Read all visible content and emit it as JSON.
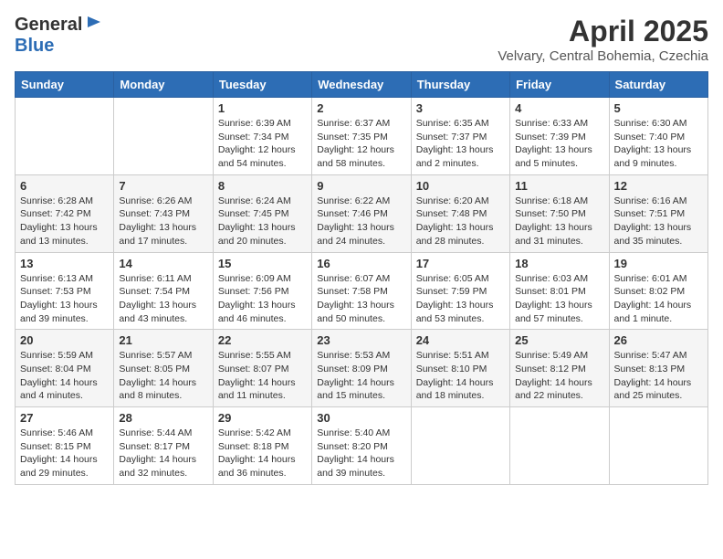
{
  "header": {
    "logo": {
      "general": "General",
      "blue": "Blue"
    },
    "title": "April 2025",
    "location": "Velvary, Central Bohemia, Czechia"
  },
  "weekdays": [
    "Sunday",
    "Monday",
    "Tuesday",
    "Wednesday",
    "Thursday",
    "Friday",
    "Saturday"
  ],
  "weeks": [
    [
      {
        "day": "",
        "sunrise": "",
        "sunset": "",
        "daylight": ""
      },
      {
        "day": "",
        "sunrise": "",
        "sunset": "",
        "daylight": ""
      },
      {
        "day": "1",
        "sunrise": "Sunrise: 6:39 AM",
        "sunset": "Sunset: 7:34 PM",
        "daylight": "Daylight: 12 hours and 54 minutes."
      },
      {
        "day": "2",
        "sunrise": "Sunrise: 6:37 AM",
        "sunset": "Sunset: 7:35 PM",
        "daylight": "Daylight: 12 hours and 58 minutes."
      },
      {
        "day": "3",
        "sunrise": "Sunrise: 6:35 AM",
        "sunset": "Sunset: 7:37 PM",
        "daylight": "Daylight: 13 hours and 2 minutes."
      },
      {
        "day": "4",
        "sunrise": "Sunrise: 6:33 AM",
        "sunset": "Sunset: 7:39 PM",
        "daylight": "Daylight: 13 hours and 5 minutes."
      },
      {
        "day": "5",
        "sunrise": "Sunrise: 6:30 AM",
        "sunset": "Sunset: 7:40 PM",
        "daylight": "Daylight: 13 hours and 9 minutes."
      }
    ],
    [
      {
        "day": "6",
        "sunrise": "Sunrise: 6:28 AM",
        "sunset": "Sunset: 7:42 PM",
        "daylight": "Daylight: 13 hours and 13 minutes."
      },
      {
        "day": "7",
        "sunrise": "Sunrise: 6:26 AM",
        "sunset": "Sunset: 7:43 PM",
        "daylight": "Daylight: 13 hours and 17 minutes."
      },
      {
        "day": "8",
        "sunrise": "Sunrise: 6:24 AM",
        "sunset": "Sunset: 7:45 PM",
        "daylight": "Daylight: 13 hours and 20 minutes."
      },
      {
        "day": "9",
        "sunrise": "Sunrise: 6:22 AM",
        "sunset": "Sunset: 7:46 PM",
        "daylight": "Daylight: 13 hours and 24 minutes."
      },
      {
        "day": "10",
        "sunrise": "Sunrise: 6:20 AM",
        "sunset": "Sunset: 7:48 PM",
        "daylight": "Daylight: 13 hours and 28 minutes."
      },
      {
        "day": "11",
        "sunrise": "Sunrise: 6:18 AM",
        "sunset": "Sunset: 7:50 PM",
        "daylight": "Daylight: 13 hours and 31 minutes."
      },
      {
        "day": "12",
        "sunrise": "Sunrise: 6:16 AM",
        "sunset": "Sunset: 7:51 PM",
        "daylight": "Daylight: 13 hours and 35 minutes."
      }
    ],
    [
      {
        "day": "13",
        "sunrise": "Sunrise: 6:13 AM",
        "sunset": "Sunset: 7:53 PM",
        "daylight": "Daylight: 13 hours and 39 minutes."
      },
      {
        "day": "14",
        "sunrise": "Sunrise: 6:11 AM",
        "sunset": "Sunset: 7:54 PM",
        "daylight": "Daylight: 13 hours and 43 minutes."
      },
      {
        "day": "15",
        "sunrise": "Sunrise: 6:09 AM",
        "sunset": "Sunset: 7:56 PM",
        "daylight": "Daylight: 13 hours and 46 minutes."
      },
      {
        "day": "16",
        "sunrise": "Sunrise: 6:07 AM",
        "sunset": "Sunset: 7:58 PM",
        "daylight": "Daylight: 13 hours and 50 minutes."
      },
      {
        "day": "17",
        "sunrise": "Sunrise: 6:05 AM",
        "sunset": "Sunset: 7:59 PM",
        "daylight": "Daylight: 13 hours and 53 minutes."
      },
      {
        "day": "18",
        "sunrise": "Sunrise: 6:03 AM",
        "sunset": "Sunset: 8:01 PM",
        "daylight": "Daylight: 13 hours and 57 minutes."
      },
      {
        "day": "19",
        "sunrise": "Sunrise: 6:01 AM",
        "sunset": "Sunset: 8:02 PM",
        "daylight": "Daylight: 14 hours and 1 minute."
      }
    ],
    [
      {
        "day": "20",
        "sunrise": "Sunrise: 5:59 AM",
        "sunset": "Sunset: 8:04 PM",
        "daylight": "Daylight: 14 hours and 4 minutes."
      },
      {
        "day": "21",
        "sunrise": "Sunrise: 5:57 AM",
        "sunset": "Sunset: 8:05 PM",
        "daylight": "Daylight: 14 hours and 8 minutes."
      },
      {
        "day": "22",
        "sunrise": "Sunrise: 5:55 AM",
        "sunset": "Sunset: 8:07 PM",
        "daylight": "Daylight: 14 hours and 11 minutes."
      },
      {
        "day": "23",
        "sunrise": "Sunrise: 5:53 AM",
        "sunset": "Sunset: 8:09 PM",
        "daylight": "Daylight: 14 hours and 15 minutes."
      },
      {
        "day": "24",
        "sunrise": "Sunrise: 5:51 AM",
        "sunset": "Sunset: 8:10 PM",
        "daylight": "Daylight: 14 hours and 18 minutes."
      },
      {
        "day": "25",
        "sunrise": "Sunrise: 5:49 AM",
        "sunset": "Sunset: 8:12 PM",
        "daylight": "Daylight: 14 hours and 22 minutes."
      },
      {
        "day": "26",
        "sunrise": "Sunrise: 5:47 AM",
        "sunset": "Sunset: 8:13 PM",
        "daylight": "Daylight: 14 hours and 25 minutes."
      }
    ],
    [
      {
        "day": "27",
        "sunrise": "Sunrise: 5:46 AM",
        "sunset": "Sunset: 8:15 PM",
        "daylight": "Daylight: 14 hours and 29 minutes."
      },
      {
        "day": "28",
        "sunrise": "Sunrise: 5:44 AM",
        "sunset": "Sunset: 8:17 PM",
        "daylight": "Daylight: 14 hours and 32 minutes."
      },
      {
        "day": "29",
        "sunrise": "Sunrise: 5:42 AM",
        "sunset": "Sunset: 8:18 PM",
        "daylight": "Daylight: 14 hours and 36 minutes."
      },
      {
        "day": "30",
        "sunrise": "Sunrise: 5:40 AM",
        "sunset": "Sunset: 8:20 PM",
        "daylight": "Daylight: 14 hours and 39 minutes."
      },
      {
        "day": "",
        "sunrise": "",
        "sunset": "",
        "daylight": ""
      },
      {
        "day": "",
        "sunrise": "",
        "sunset": "",
        "daylight": ""
      },
      {
        "day": "",
        "sunrise": "",
        "sunset": "",
        "daylight": ""
      }
    ]
  ]
}
